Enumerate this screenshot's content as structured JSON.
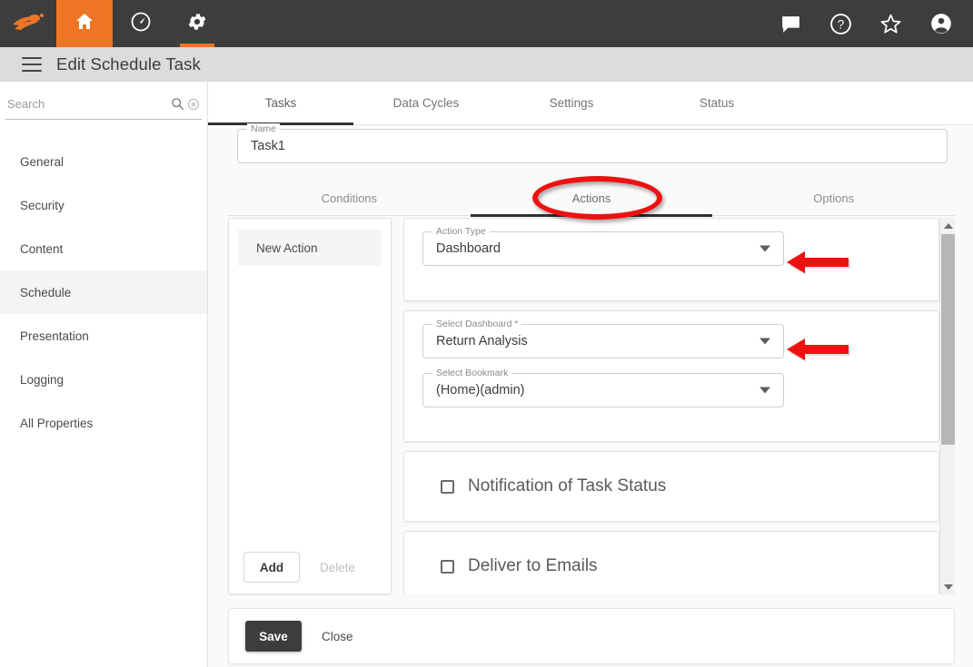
{
  "topnav": {
    "logo_icon": "comet-logo-icon",
    "items": [
      {
        "icon": "home-icon",
        "active": true
      },
      {
        "icon": "gauge-icon",
        "active": false
      },
      {
        "icon": "gear-icon",
        "active": false
      }
    ],
    "right_items": [
      {
        "icon": "chat-icon"
      },
      {
        "icon": "help-icon"
      },
      {
        "icon": "star-icon"
      },
      {
        "icon": "account-icon"
      }
    ],
    "accent_color": "#ee7523",
    "bar_color": "#3d3d3d"
  },
  "header": {
    "menu_icon": "hamburger-icon",
    "title": "Edit Schedule Task"
  },
  "sidebar": {
    "search": {
      "value": "",
      "placeholder": "Search",
      "search_icon": "search-icon",
      "clear_icon": "clear-circle-icon"
    },
    "items": [
      {
        "label": "General",
        "selected": false
      },
      {
        "label": "Security",
        "selected": false
      },
      {
        "label": "Content",
        "selected": false
      },
      {
        "label": "Schedule",
        "selected": true
      },
      {
        "label": "Presentation",
        "selected": false
      },
      {
        "label": "Logging",
        "selected": false
      },
      {
        "label": "All Properties",
        "selected": false
      }
    ]
  },
  "main": {
    "top_tabs": [
      {
        "label": "Tasks",
        "active": true
      },
      {
        "label": "Data Cycles",
        "active": false
      },
      {
        "label": "Settings",
        "active": false
      },
      {
        "label": "Status",
        "active": false
      }
    ],
    "name_field": {
      "label": "Name",
      "value": "Task1"
    },
    "sub_tabs": [
      {
        "label": "Conditions",
        "active": false
      },
      {
        "label": "Actions",
        "active": true
      },
      {
        "label": "Options",
        "active": false
      }
    ],
    "action_list": {
      "items": [
        {
          "label": "New Action",
          "selected": true
        }
      ],
      "add_label": "Add",
      "delete_label": "Delete"
    },
    "action_type_field": {
      "label": "Action Type",
      "value": "Dashboard"
    },
    "select_dashboard_field": {
      "label": "Select Dashboard *",
      "value": "Return Analysis"
    },
    "select_bookmark_field": {
      "label": "Select Bookmark",
      "value": "(Home)(admin)"
    },
    "notification_checkbox": {
      "label": "Notification of Task Status",
      "checked": false
    },
    "deliver_checkbox": {
      "label": "Deliver to Emails",
      "checked": false
    },
    "scrollbar": {
      "up_icon": "scroll-up-arrow-icon",
      "down_icon": "scroll-down-arrow-icon"
    }
  },
  "footer": {
    "save_label": "Save",
    "close_label": "Close"
  },
  "annotations": {
    "color": "#ee1111",
    "ellipse_target": "Actions",
    "arrow1_target": "Action Type",
    "arrow2_target": "Select Dashboard"
  }
}
